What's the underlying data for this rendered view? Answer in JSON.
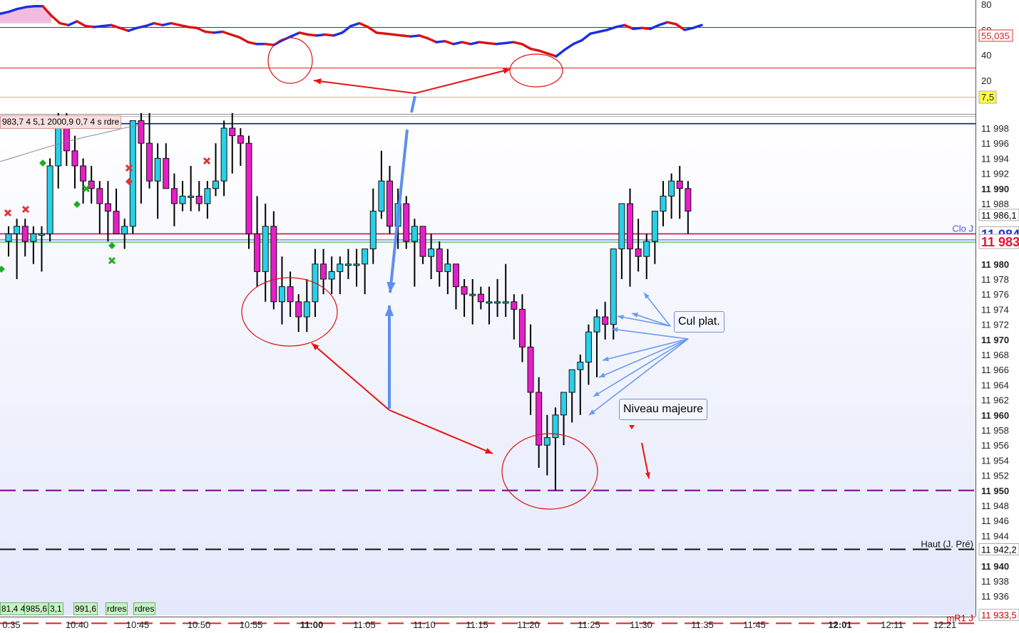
{
  "chart_data": {
    "type": "candlestick",
    "x_ticks": [
      "0:35",
      "10:40",
      "10:45",
      "10:50",
      "10:55",
      "11:00",
      "11:05",
      "11:10",
      "11:15",
      "11:20",
      "11:25",
      "11:30",
      "11:35",
      "11:45",
      "12:01",
      "12:11",
      "12:21"
    ],
    "x_ticks_bold": [
      "11:00",
      "12:01"
    ],
    "y_range": [
      11932,
      12000
    ],
    "y_ticks": [
      {
        "value": 11998,
        "label": "11 998",
        "bold": false
      },
      {
        "value": 11996,
        "label": "11 996",
        "bold": false
      },
      {
        "value": 11994,
        "label": "11 994",
        "bold": false
      },
      {
        "value": 11992,
        "label": "11 992",
        "bold": false
      },
      {
        "value": 11990,
        "label": "11 990",
        "bold": true
      },
      {
        "value": 11988,
        "label": "11 988",
        "bold": false
      },
      {
        "value": 11980,
        "label": "11 980",
        "bold": true
      },
      {
        "value": 11978,
        "label": "11 978",
        "bold": false
      },
      {
        "value": 11976,
        "label": "11 976",
        "bold": false
      },
      {
        "value": 11974,
        "label": "11 974",
        "bold": false
      },
      {
        "value": 11972,
        "label": "11 972",
        "bold": false
      },
      {
        "value": 11970,
        "label": "11 970",
        "bold": true
      },
      {
        "value": 11968,
        "label": "11 968",
        "bold": false
      },
      {
        "value": 11966,
        "label": "11 966",
        "bold": false
      },
      {
        "value": 11964,
        "label": "11 964",
        "bold": false
      },
      {
        "value": 11962,
        "label": "11 962",
        "bold": false
      },
      {
        "value": 11960,
        "label": "11 960",
        "bold": true
      },
      {
        "value": 11958,
        "label": "11 958",
        "bold": false
      },
      {
        "value": 11956,
        "label": "11 956",
        "bold": false
      },
      {
        "value": 11954,
        "label": "11 954",
        "bold": false
      },
      {
        "value": 11952,
        "label": "11 952",
        "bold": false
      },
      {
        "value": 11950,
        "label": "11 950",
        "bold": true
      },
      {
        "value": 11948,
        "label": "11 948",
        "bold": false
      },
      {
        "value": 11946,
        "label": "11 946",
        "bold": false
      },
      {
        "value": 11944,
        "label": "11 944",
        "bold": false
      },
      {
        "value": 11940,
        "label": "11 940",
        "bold": true
      },
      {
        "value": 11938,
        "label": "11 938",
        "bold": false
      },
      {
        "value": 11936,
        "label": "11 936",
        "bold": false
      }
    ],
    "price_tags": [
      {
        "value": 11986.5,
        "label": "11 986,1",
        "color": "#000000",
        "bg": "#ffffff"
      },
      {
        "value": 11984,
        "label": "11 984",
        "color": "#2233dd",
        "bg": "#ffffff"
      },
      {
        "value": 11983,
        "label": "11 983",
        "color": "#ee1133",
        "bg": "#ffffff"
      },
      {
        "value": 11942.2,
        "label": "11 942,2",
        "color": "#000000",
        "bg": "#ffffff"
      },
      {
        "value": 11933.5,
        "label": "11 933,5",
        "color": "#cc0000",
        "bg": "#ffffff"
      }
    ],
    "levels": [
      {
        "value": 11998.6,
        "color": "#0a1a99",
        "style": "solid",
        "width": 1.6
      },
      {
        "value": 11984,
        "color": "#cc1144",
        "style": "solid",
        "width": 1.6
      },
      {
        "value": 11983.2,
        "color": "#4455dd",
        "style": "solid",
        "width": 1
      },
      {
        "value": 11982.9,
        "color": "#33bb33",
        "style": "solid",
        "width": 1.2
      },
      {
        "value": 11950,
        "color": "#8a1fa0",
        "style": "dash",
        "width": 2.4
      },
      {
        "value": 11942.2,
        "color": "#111111",
        "style": "dash",
        "width": 2
      },
      {
        "value": 11932.4,
        "color": "#dd2222",
        "style": "dash",
        "width": 2
      }
    ],
    "level_labels": [
      {
        "value": 11984,
        "text": "Clo J",
        "color": "#4455dd"
      },
      {
        "value": 11942.2,
        "text": "Haut (J. Pré)",
        "color": "#111111"
      },
      {
        "value": 11932.4,
        "text": "mR1 J",
        "color": "#cc0000"
      }
    ],
    "candles": [
      [
        11983,
        11985,
        11981,
        11984
      ],
      [
        11984,
        11986,
        11978,
        11985
      ],
      [
        11985,
        11986,
        11981,
        11983
      ],
      [
        11983,
        11985,
        11980,
        11984
      ],
      [
        11984,
        11985,
        11979,
        11984
      ],
      [
        11984,
        11994,
        11983,
        11993
      ],
      [
        11993,
        12000,
        11990,
        11999
      ],
      [
        11999,
        12000,
        11993,
        11995
      ],
      [
        11995,
        11997,
        11990,
        11993
      ],
      [
        11993,
        11994,
        11988,
        11991
      ],
      [
        11991,
        11993,
        11988,
        11990
      ],
      [
        11990,
        11991,
        11984,
        11988
      ],
      [
        11988,
        11991,
        11983,
        11987
      ],
      [
        11987,
        11990,
        11984,
        11984
      ],
      [
        11984,
        11986,
        11982,
        11985
      ],
      [
        11985,
        11995,
        11984,
        11999
      ],
      [
        11999,
        12000,
        11988,
        11996
      ],
      [
        11996,
        12000,
        11990,
        11991
      ],
      [
        11991,
        11996,
        11986,
        11994
      ],
      [
        11994,
        11996,
        11990,
        11990
      ],
      [
        11990,
        11992,
        11985,
        11988
      ],
      [
        11988,
        11991,
        11987,
        11989
      ],
      [
        11989,
        11993,
        11987,
        11989
      ],
      [
        11989,
        11991,
        11987,
        11988
      ],
      [
        11988,
        11991,
        11986,
        11990
      ],
      [
        11990,
        11996,
        11989,
        11991
      ],
      [
        11991,
        11999,
        11989,
        11998
      ],
      [
        11998,
        12000,
        11992,
        11997
      ],
      [
        11997,
        11998,
        11993,
        11996
      ],
      [
        11996,
        11997,
        11982,
        11984
      ],
      [
        11984,
        11989,
        11977,
        11979
      ],
      [
        11979,
        11988,
        11975,
        11985
      ],
      [
        11985,
        11987,
        11974,
        11975
      ],
      [
        11975,
        11981,
        11972,
        11977
      ],
      [
        11977,
        11979,
        11973,
        11975
      ],
      [
        11975,
        11976,
        11971,
        11973
      ],
      [
        11973,
        11978,
        11971,
        11975
      ],
      [
        11975,
        11982,
        11973,
        11980
      ],
      [
        11980,
        11982,
        11976,
        11978
      ],
      [
        11978,
        11981,
        11976,
        11979
      ],
      [
        11979,
        11981,
        11976,
        11980
      ],
      [
        11980,
        11982,
        11978,
        11980
      ],
      [
        11980,
        11982,
        11977,
        11980
      ],
      [
        11980,
        11982,
        11976,
        11982
      ],
      [
        11982,
        11990,
        11980,
        11987
      ],
      [
        11987,
        11995,
        11986,
        11991
      ],
      [
        11991,
        11993,
        11984,
        11985
      ],
      [
        11985,
        11990,
        11982,
        11988
      ],
      [
        11988,
        11989,
        11982,
        11983
      ],
      [
        11983,
        11986,
        11977,
        11985
      ],
      [
        11985,
        11985,
        11980,
        11981
      ],
      [
        11981,
        11984,
        11978,
        11982
      ],
      [
        11982,
        11983,
        11977,
        11979
      ],
      [
        11979,
        11982,
        11976,
        11980
      ],
      [
        11980,
        11980,
        11974,
        11977
      ],
      [
        11977,
        11978,
        11973,
        11976
      ],
      [
        11976,
        11978,
        11972,
        11976
      ],
      [
        11976,
        11977,
        11974,
        11975
      ],
      [
        11975,
        11977,
        11972,
        11975
      ],
      [
        11975,
        11978,
        11973,
        11975
      ],
      [
        11975,
        11980,
        11973,
        11975
      ],
      [
        11975,
        11976,
        11970,
        11974
      ],
      [
        11974,
        11976,
        11967,
        11969
      ],
      [
        11969,
        11972,
        11960,
        11963
      ],
      [
        11963,
        11965,
        11953,
        11956
      ],
      [
        11956,
        11960,
        11952,
        11957
      ],
      [
        11957,
        11961,
        11950,
        11960
      ],
      [
        11960,
        11962,
        11956,
        11963
      ],
      [
        11963,
        11966,
        11959,
        11966
      ],
      [
        11966,
        11968,
        11960,
        11967
      ],
      [
        11967,
        11972,
        11964,
        11971
      ],
      [
        11971,
        11974,
        11965,
        11973
      ],
      [
        11973,
        11975,
        11970,
        11972
      ],
      [
        11972,
        11980,
        11970,
        11982
      ],
      [
        11982,
        11988,
        11978,
        11988
      ],
      [
        11988,
        11990,
        11977,
        11982
      ],
      [
        11982,
        11986,
        11979,
        11981
      ],
      [
        11981,
        11984,
        11978,
        11983
      ],
      [
        11983,
        11987,
        11980,
        11987
      ],
      [
        11987,
        11991,
        11985,
        11989
      ],
      [
        11989,
        11992,
        11986,
        11991
      ],
      [
        11991,
        11993,
        11986,
        11990
      ],
      [
        11990,
        11991,
        11984,
        11987
      ]
    ],
    "oscillator": {
      "y_range": [
        0,
        80
      ],
      "y_ticks": [
        "80",
        "60",
        "40",
        "20"
      ],
      "upper_level": "55,035",
      "lower_level": "7,5",
      "values": [
        70,
        72,
        75,
        77,
        78,
        78,
        68,
        60,
        58,
        62,
        57,
        56,
        57,
        58,
        55,
        52,
        55,
        57,
        60,
        58,
        60,
        58,
        56,
        55,
        51,
        50,
        51,
        48,
        45,
        40,
        38,
        38,
        37,
        42,
        46,
        50,
        48,
        47,
        48,
        47,
        50,
        57,
        60,
        56,
        50,
        49,
        48,
        47,
        46,
        47,
        44,
        40,
        41,
        38,
        40,
        38,
        40,
        39,
        38,
        39,
        40,
        38,
        33,
        31,
        28,
        25,
        32,
        38,
        42,
        49,
        51,
        53,
        56,
        58,
        54,
        55,
        54,
        58,
        61,
        59,
        53,
        55,
        58
      ]
    },
    "annotations": [
      "Cul plat.",
      "Niveau majeure"
    ],
    "indicator_text_top": "983,7 4 5,1 2000,9 0,7 4 s rdre",
    "indicator_text_bottom": [
      "81,4 4",
      "985,6",
      "3,1",
      "991,6",
      "rdres",
      "rdres"
    ]
  }
}
